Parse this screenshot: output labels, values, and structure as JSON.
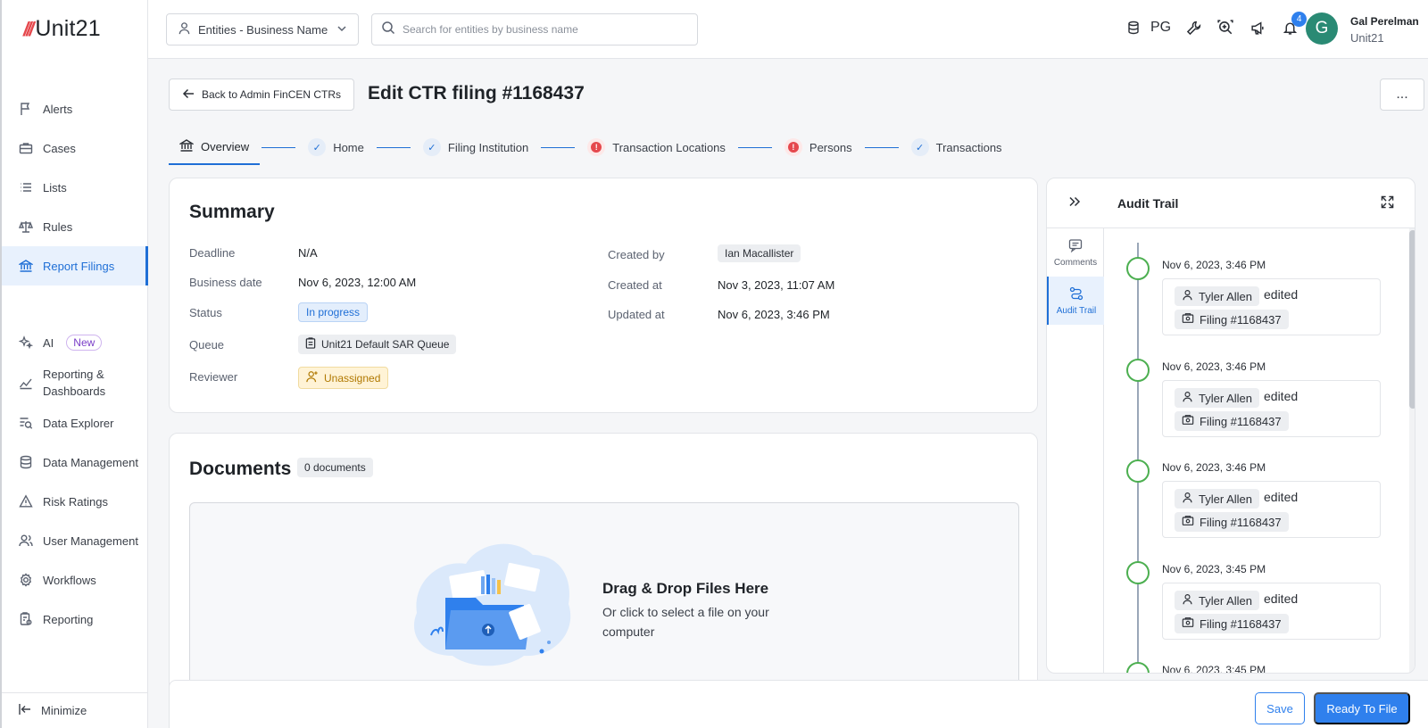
{
  "brand": {
    "mark": "///",
    "name": "Unit21"
  },
  "sidebar": {
    "items": [
      {
        "label": "Alerts",
        "icon": "flag-icon"
      },
      {
        "label": "Cases",
        "icon": "briefcase-icon"
      },
      {
        "label": "Lists",
        "icon": "list-icon"
      },
      {
        "label": "Rules",
        "icon": "scale-icon"
      },
      {
        "label": "Report Filings",
        "icon": "bank-icon",
        "active": true
      },
      {
        "label": "AI",
        "icon": "sparkle-icon",
        "badge": "New"
      },
      {
        "label": "Reporting & Dashboards",
        "icon": "chart-icon"
      },
      {
        "label": "Data Explorer",
        "icon": "data-search-icon"
      },
      {
        "label": "Data Management",
        "icon": "database-icon"
      },
      {
        "label": "Risk Ratings",
        "icon": "warning-icon"
      },
      {
        "label": "User Management",
        "icon": "users-icon"
      },
      {
        "label": "Workflows",
        "icon": "gear-icon"
      },
      {
        "label": "Reporting",
        "icon": "report-icon"
      }
    ],
    "minimize": "Minimize"
  },
  "topbar": {
    "entity_select": "Entities - Business Name",
    "search_placeholder": "Search for entities by business name",
    "org_code": "PG",
    "notification_count": "4",
    "avatar_initial": "G",
    "user_name": "Gal Perelman",
    "user_org": "Unit21"
  },
  "header": {
    "back_label": "Back to Admin FinCEN CTRs",
    "title": "Edit CTR filing #1168437",
    "more_label": "..."
  },
  "stepper": {
    "steps": [
      {
        "label": "Overview",
        "state": "current"
      },
      {
        "label": "Home",
        "state": "complete"
      },
      {
        "label": "Filing Institution",
        "state": "complete"
      },
      {
        "label": "Transaction Locations",
        "state": "error"
      },
      {
        "label": "Persons",
        "state": "error"
      },
      {
        "label": "Transactions",
        "state": "complete"
      }
    ]
  },
  "summary": {
    "title": "Summary",
    "deadline_label": "Deadline",
    "deadline": "N/A",
    "business_date_label": "Business date",
    "business_date": "Nov 6, 2023, 12:00 AM",
    "status_label": "Status",
    "status": "In progress",
    "queue_label": "Queue",
    "queue": "Unit21 Default SAR Queue",
    "reviewer_label": "Reviewer",
    "reviewer": "Unassigned",
    "created_by_label": "Created by",
    "created_by": "Ian Macallister",
    "created_at_label": "Created at",
    "created_at": "Nov 3, 2023, 11:07 AM",
    "updated_at_label": "Updated at",
    "updated_at": "Nov 6, 2023, 3:46 PM"
  },
  "documents": {
    "title": "Documents",
    "count": "0 documents",
    "drop_title": "Drag & Drop Files Here",
    "drop_sub": "Or click to select a file on your computer"
  },
  "audit": {
    "title": "Audit Trail",
    "tabs": [
      {
        "label": "Comments"
      },
      {
        "label": "Audit Trail",
        "active": true
      }
    ],
    "entries": [
      {
        "time": "Nov 6, 2023, 3:46 PM",
        "user": "Tyler Allen",
        "action": "edited",
        "target": "Filing #1168437"
      },
      {
        "time": "Nov 6, 2023, 3:46 PM",
        "user": "Tyler Allen",
        "action": "edited",
        "target": "Filing #1168437"
      },
      {
        "time": "Nov 6, 2023, 3:46 PM",
        "user": "Tyler Allen",
        "action": "edited",
        "target": "Filing #1168437"
      },
      {
        "time": "Nov 6, 2023, 3:45 PM",
        "user": "Tyler Allen",
        "action": "edited",
        "target": "Filing #1168437"
      },
      {
        "time": "Nov 6, 2023, 3:45 PM",
        "user": "",
        "action": "",
        "target": ""
      }
    ]
  },
  "footer": {
    "save": "Save",
    "ready": "Ready To File"
  },
  "colors": {
    "primary": "#2f80ed",
    "error": "#e5484d",
    "success": "#4caf50",
    "avatar": "#2a8a74"
  }
}
